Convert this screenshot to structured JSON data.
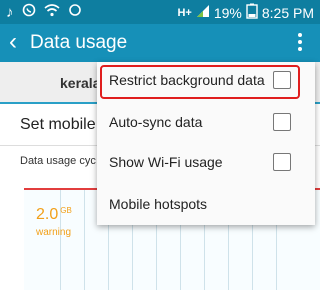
{
  "statusbar": {
    "signal_text": "H+",
    "battery_percent": "19%",
    "time": "8:25 PM",
    "icons": [
      "music-note-icon",
      "whatsapp-icon",
      "wifi-icon",
      "sync-icon",
      "mobile-signal-icon",
      "battery-icon"
    ]
  },
  "appbar": {
    "title": "Data usage"
  },
  "tabs": {
    "active_label": "kerala"
  },
  "main": {
    "set_mobile_label": "Set mobile d",
    "cycle_label": "Data usage cyc",
    "warning_value": "2.0",
    "warning_unit": "GB",
    "warning_label": "warning"
  },
  "menu": {
    "items": [
      {
        "label": "Restrict background data",
        "checked": false
      },
      {
        "label": "Auto-sync data",
        "checked": false
      },
      {
        "label": "Show Wi-Fi usage",
        "checked": false
      },
      {
        "label": "Mobile hotspots"
      }
    ]
  },
  "colors": {
    "appbar": "#1690b8",
    "statusbar": "#0e7ea0",
    "highlight": "#e01e1e",
    "warning": "#f2a019"
  }
}
